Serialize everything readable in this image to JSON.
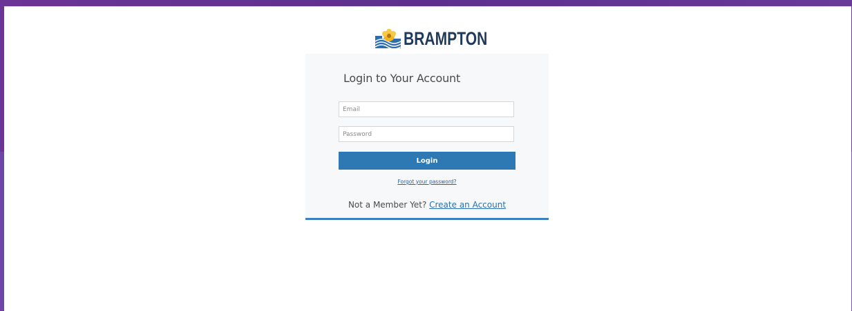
{
  "brand": {
    "name": "BRAMPTON",
    "colors": {
      "text": "#1f3a5a",
      "mark_blue": "#2d6cb0",
      "mark_gold": "#f2b51f"
    }
  },
  "login": {
    "title": "Login to Your Account",
    "email_placeholder": "Email",
    "password_placeholder": "Password",
    "button_label": "Login",
    "forgot_link": "Forgot your password?",
    "signup_prompt": "Not a Member Yet?",
    "signup_link": "Create an Account"
  },
  "colors": {
    "accent": "#2e78b3",
    "background": "#6a3a9a"
  }
}
